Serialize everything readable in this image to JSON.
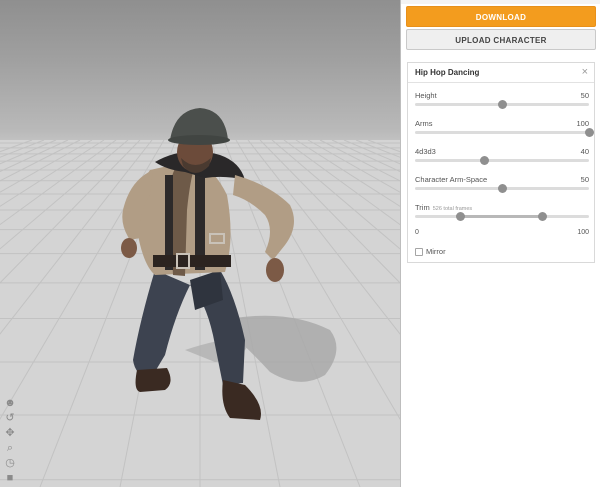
{
  "buttons": {
    "download": "DOWNLOAD",
    "upload": "UPLOAD CHARACTER"
  },
  "animation_panel": {
    "title": "Hip Hop Dancing",
    "close_icon": "×",
    "sliders": [
      {
        "label": "Height",
        "value": "50",
        "fraction": 0.5
      },
      {
        "label": "Arms",
        "value": "100",
        "fraction": 1.0
      },
      {
        "label": "4d3d3",
        "value": "40",
        "fraction": 0.4
      },
      {
        "label": "Character Arm-Space",
        "value": "50",
        "fraction": 0.5
      }
    ],
    "trim": {
      "label": "Trim",
      "frames": "526 total frames",
      "min": "0",
      "max": "100",
      "start_fraction": 0.26,
      "end_fraction": 0.73
    },
    "mirror_label": "Mirror",
    "mirror_checked": false
  },
  "viewport_tools": [
    {
      "name": "character-icon",
      "glyph": "☻"
    },
    {
      "name": "undo-icon",
      "glyph": "↺"
    },
    {
      "name": "pan-icon",
      "glyph": "✥"
    },
    {
      "name": "zoom-icon",
      "glyph": "⌕"
    },
    {
      "name": "reset-icon",
      "glyph": "◷"
    },
    {
      "name": "camera-icon",
      "glyph": "■"
    }
  ],
  "colors": {
    "accent": "#f39c1e",
    "floor": "#d4d4d4",
    "background": "#9a9a9a"
  }
}
